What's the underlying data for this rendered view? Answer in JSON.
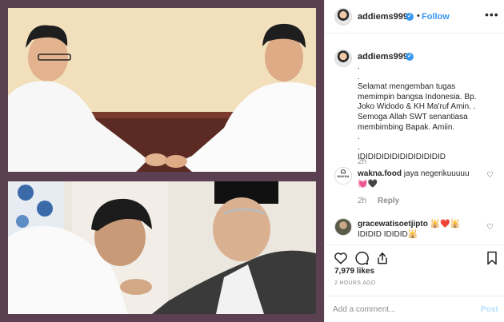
{
  "post": {
    "username": "addiems999",
    "verified_mark": "✓",
    "separator": "•",
    "follow_label": "Follow",
    "more_label": "•••"
  },
  "caption": {
    "username": "addiems999",
    "text": ".\n.\nSelamat mengemban tugas memimpin bangsa Indonesia. Bp. Joko Widodo & KH Ma'ruf Amin. .\nSemoga Allah SWT senantiasa membimbing Bapak. Amiin.\n.\n.\nIDIDIDIDIDIDIDIDIDIDID",
    "time": "2h"
  },
  "comments": [
    {
      "username": "wakna.food",
      "text": "jaya negerikuuuuu💓🖤",
      "time": "2h",
      "reply_label": "Reply",
      "avatar_label": "WAKNA"
    },
    {
      "username": "gracewatisoetjipto",
      "text": "🕌❤️🕌IDIDID IDIDID🕌"
    }
  ],
  "likes": "7,979 likes",
  "posted_ago": "2 HOURS AGO",
  "add_comment": {
    "placeholder": "Add a comment...",
    "post_label": "Post"
  },
  "icons": [
    "heart-icon",
    "comment-icon",
    "share-icon",
    "bookmark-icon",
    "more-icon"
  ],
  "colors": {
    "link": "#3897f0",
    "muted": "#8e8e8e",
    "text": "#262626",
    "frame": "#5a4050"
  }
}
